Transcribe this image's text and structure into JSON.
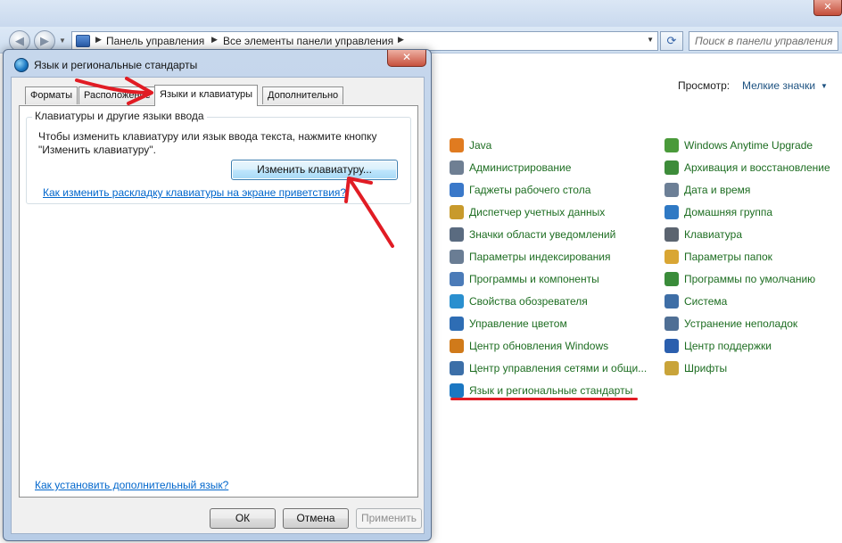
{
  "explorer": {
    "breadcrumb": [
      "Панель управления",
      "Все элементы панели управления"
    ],
    "search_placeholder": "Поиск в панели управления",
    "view_label": "Просмотр:",
    "view_value": "Мелкие значки",
    "items_left": [
      {
        "label": "Java",
        "icon": "java-icon",
        "color": "#e07b20"
      },
      {
        "label": "Администрирование",
        "icon": "admin-tools-icon",
        "color": "#6f7f93"
      },
      {
        "label": "Гаджеты рабочего стола",
        "icon": "gadgets-icon",
        "color": "#3a78c9"
      },
      {
        "label": "Диспетчер учетных данных",
        "icon": "credential-manager-icon",
        "color": "#c89a2c"
      },
      {
        "label": "Значки области уведомлений",
        "icon": "notification-icons-icon",
        "color": "#5a6b80"
      },
      {
        "label": "Параметры индексирования",
        "icon": "indexing-icon",
        "color": "#6a7d94"
      },
      {
        "label": "Программы и компоненты",
        "icon": "programs-icon",
        "color": "#4b7bb8"
      },
      {
        "label": "Свойства обозревателя",
        "icon": "internet-options-icon",
        "color": "#2a8fcf"
      },
      {
        "label": "Управление цветом",
        "icon": "color-management-icon",
        "color": "#2e6db4"
      },
      {
        "label": "Центр обновления Windows",
        "icon": "windows-update-icon",
        "color": "#d07a1a"
      },
      {
        "label": "Центр управления сетями и общи...",
        "icon": "network-center-icon",
        "color": "#3c6fa8"
      },
      {
        "label": "Язык и региональные стандарты",
        "icon": "globe-icon",
        "color": "#1b77c2"
      }
    ],
    "items_right": [
      {
        "label": "Windows Anytime Upgrade",
        "icon": "anytime-upgrade-icon",
        "color": "#4a9a3a"
      },
      {
        "label": "Архивация и восстановление",
        "icon": "backup-icon",
        "color": "#3d8c3a"
      },
      {
        "label": "Дата и время",
        "icon": "clock-icon",
        "color": "#6c7f96"
      },
      {
        "label": "Домашняя группа",
        "icon": "homegroup-icon",
        "color": "#2f79c4"
      },
      {
        "label": "Клавиатура",
        "icon": "keyboard-icon",
        "color": "#5b6470"
      },
      {
        "label": "Параметры папок",
        "icon": "folder-options-icon",
        "color": "#d9a634"
      },
      {
        "label": "Программы по умолчанию",
        "icon": "default-programs-icon",
        "color": "#3a8c3a"
      },
      {
        "label": "Система",
        "icon": "system-icon",
        "color": "#3e6ea6"
      },
      {
        "label": "Устранение неполадок",
        "icon": "troubleshooting-icon",
        "color": "#4f6f95"
      },
      {
        "label": "Центр поддержки",
        "icon": "action-center-icon",
        "color": "#2b5fae"
      },
      {
        "label": "Шрифты",
        "icon": "fonts-icon",
        "color": "#c9a43a"
      }
    ]
  },
  "dialog": {
    "title": "Язык и региональные стандарты",
    "tabs": [
      "Форматы",
      "Расположение",
      "Языки и клавиатуры",
      "Дополнительно"
    ],
    "active_tab": 2,
    "group_title": "Клавиатуры и другие языки ввода",
    "group_desc_line1": "Чтобы изменить клавиатуру или язык ввода текста, нажмите кнопку",
    "group_desc_line2": "\"Изменить клавиатуру\".",
    "change_keyboard_button": "Изменить клавиатуру...",
    "welcome_screen_link": "Как изменить раскладку клавиатуры на экране приветствия?",
    "install_language_link": "Как установить дополнительный язык?",
    "ok_button": "ОК",
    "cancel_button": "Отмена",
    "apply_button": "Применить"
  },
  "colors": {
    "annotation_red": "#e11c24",
    "link_blue": "#0066cc",
    "item_green": "#1d6d21"
  }
}
